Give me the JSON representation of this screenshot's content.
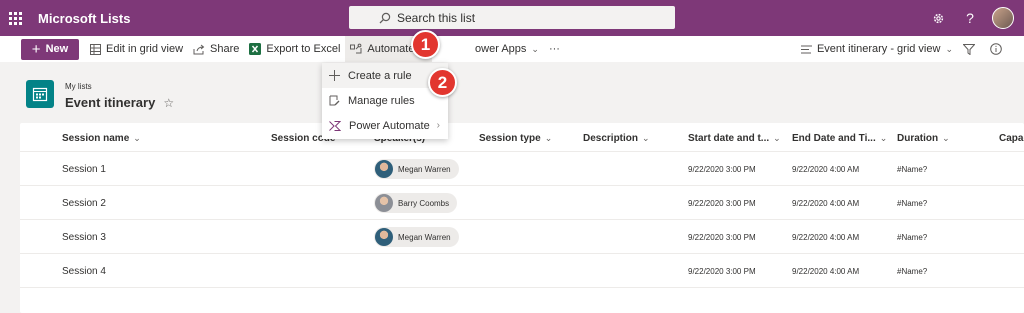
{
  "suite": {
    "app_title": "Microsoft Lists",
    "search_placeholder": "Search this list",
    "settings_icon": "gear-icon",
    "help_label": "?"
  },
  "commandbar": {
    "new_label": "New",
    "edit_grid_label": "Edit in grid view",
    "share_label": "Share",
    "export_label": "Export to Excel",
    "automate_label": "Automate",
    "powerapps_label": "ower Apps",
    "more_label": "···",
    "view_label": "Event itinerary - grid view"
  },
  "automate_menu": {
    "items": [
      {
        "label": "Create a rule"
      },
      {
        "label": "Manage rules"
      },
      {
        "label": "Power Automate"
      }
    ]
  },
  "badges": {
    "one": "1",
    "two": "2"
  },
  "list": {
    "breadcrumb": "My lists",
    "title": "Event itinerary",
    "star": "☆"
  },
  "grid": {
    "headers": {
      "session_name": "Session name",
      "session_code": "Session code",
      "speaker": "Speaker(s)",
      "session_type": "Session type",
      "description": "Description",
      "start_date": "Start date and t...",
      "end_date": "End Date and Ti...",
      "duration": "Duration",
      "capacity": "Capac"
    },
    "rows": [
      {
        "session_name": "Session 1",
        "speaker": "Megan Warren",
        "start": "9/22/2020 3:00 PM",
        "end": "9/22/2020 4:00 AM",
        "duration": "#Name?"
      },
      {
        "session_name": "Session 2",
        "speaker": "Barry Coombs",
        "start": "9/22/2020 3:00 PM",
        "end": "9/22/2020 4:00 AM",
        "duration": "#Name?"
      },
      {
        "session_name": "Session 3",
        "speaker": "Megan Warren",
        "start": "9/22/2020 3:00 PM",
        "end": "9/22/2020 4:00 AM",
        "duration": "#Name?"
      },
      {
        "session_name": "Session 4",
        "speaker": "",
        "start": "9/22/2020 3:00 PM",
        "end": "9/22/2020 4:00 AM",
        "duration": "#Name?"
      }
    ]
  },
  "colors": {
    "brand": "#7e3878",
    "list_icon": "#038387",
    "badge": "#e2362f"
  }
}
